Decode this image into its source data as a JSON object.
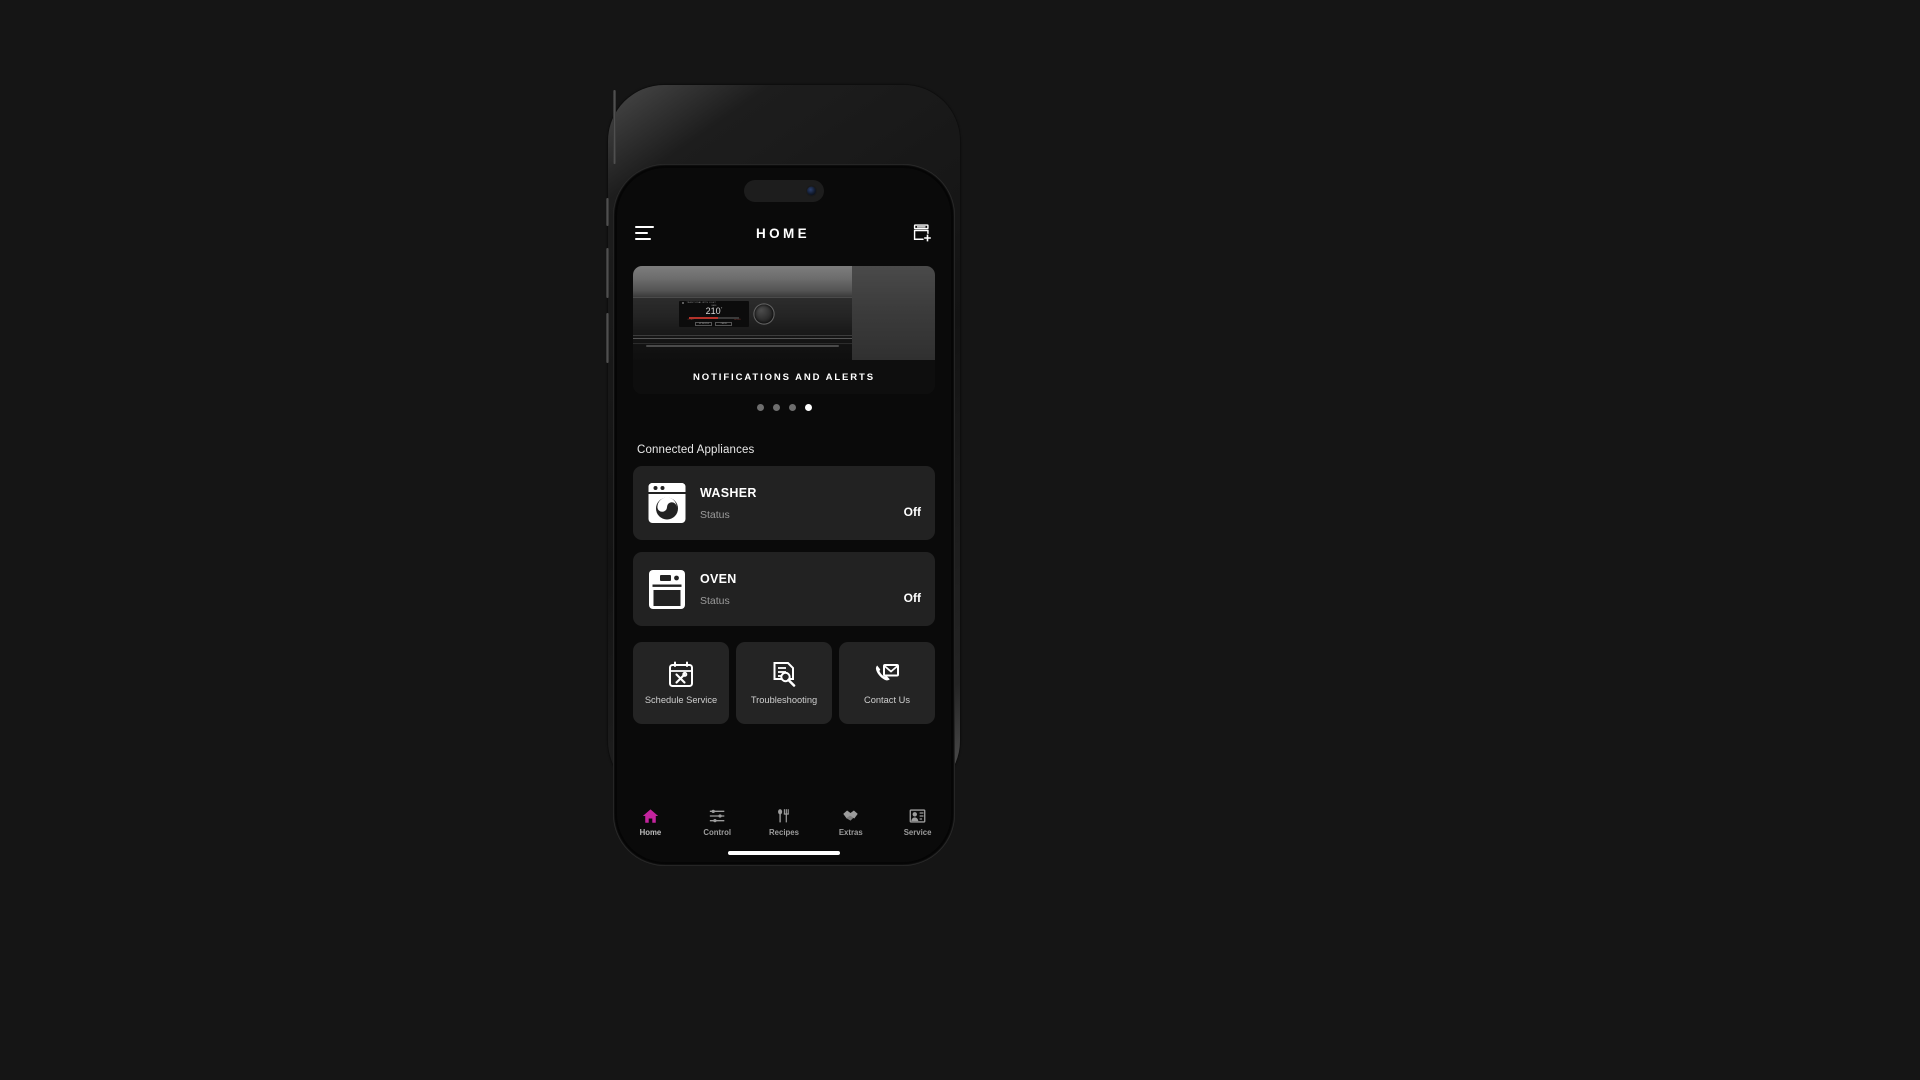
{
  "app": {
    "header": {
      "title": "HOME",
      "menu_icon": "hamburger-menu-icon",
      "add_icon": "add-appliance-icon"
    },
    "carousel": {
      "caption": "NOTIFICATIONS AND ALERTS",
      "dot_count": 4,
      "active_dot_index": 3,
      "hero": {
        "appliance": "oven",
        "display": {
          "mode": "TRADITIONAL WITH LIGHT",
          "sub_label": "BAKE",
          "temperature": "210",
          "degree_symbol": "°",
          "progress_left": "CLEAN",
          "progress_right": "240 MIN",
          "button_left": "MY RECIPES",
          "button_right": "CANCEL"
        }
      }
    },
    "section_label": "Connected Appliances",
    "appliances": [
      {
        "name": "WASHER",
        "status_label": "Status",
        "status_value": "Off",
        "icon": "washer-icon"
      },
      {
        "name": "OVEN",
        "status_label": "Status",
        "status_value": "Off",
        "icon": "oven-icon"
      }
    ],
    "quick_actions": [
      {
        "label": "Schedule Service",
        "icon": "calendar-tools-icon"
      },
      {
        "label": "Troubleshooting",
        "icon": "document-wrench-icon"
      },
      {
        "label": "Contact Us",
        "icon": "phone-envelope-icon"
      }
    ],
    "bottom_nav": {
      "active_index": 0,
      "active_color": "#C4249E",
      "items": [
        {
          "label": "Home",
          "icon": "house-icon"
        },
        {
          "label": "Control",
          "icon": "sliders-icon"
        },
        {
          "label": "Recipes",
          "icon": "spoon-fork-icon"
        },
        {
          "label": "Extras",
          "icon": "handshake-icon"
        },
        {
          "label": "Service",
          "icon": "person-card-icon"
        }
      ]
    }
  }
}
